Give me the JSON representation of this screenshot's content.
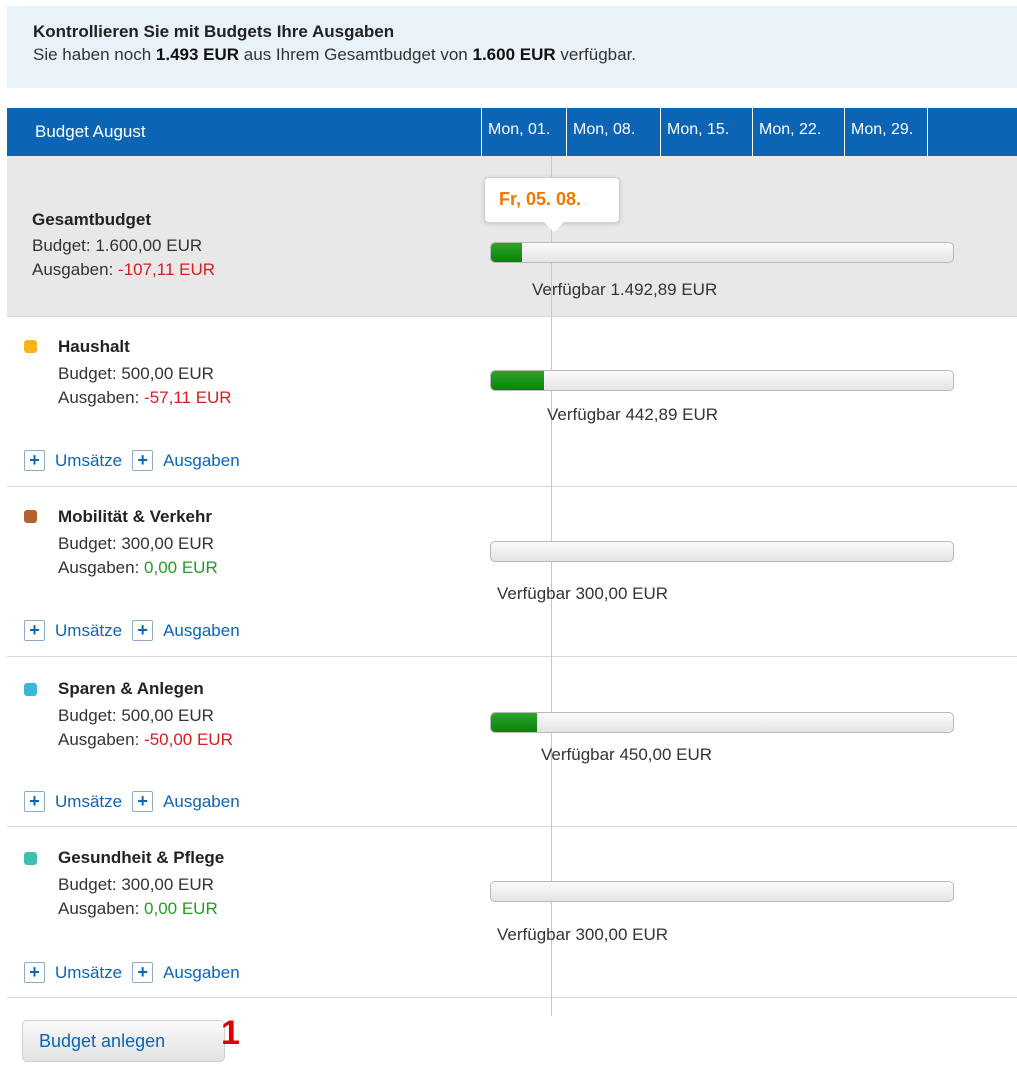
{
  "banner": {
    "title": "Kontrollieren Sie mit Budgets Ihre Ausgaben",
    "text_prefix": "Sie haben noch",
    "remaining": "1.493 EUR",
    "text_mid": "aus Ihrem Gesamtbudget von",
    "total": "1.600 EUR",
    "text_suffix": "verfügbar."
  },
  "header": {
    "title": "Budget August",
    "weeks": [
      "Mon, 01.",
      "Mon, 08.",
      "Mon, 15.",
      "Mon, 22.",
      "Mon, 29."
    ]
  },
  "tooltip": {
    "date": "Fr, 05. 08."
  },
  "total": {
    "name": "Gesamtbudget",
    "budget": "Budget: 1.600,00 EUR",
    "expenses_label": "Ausgaben:",
    "expenses": "-107,11 EUR",
    "available": "Verfügbar  1.492,89 EUR",
    "spent_fraction": 0.067
  },
  "categories": [
    {
      "name": "Haushalt",
      "color": "#f7b418",
      "budget": "Budget: 500,00 EUR",
      "expenses_label": "Ausgaben:",
      "expenses": "-57,11 EUR",
      "expenses_state": "neg",
      "available": "Verfügbar  442,89 EUR",
      "spent_fraction": 0.114,
      "link_transactions": "Umsätze",
      "link_expenses": "Ausgaben"
    },
    {
      "name": "Mobilität & Verkehr",
      "color": "#b0632a",
      "budget": "Budget: 300,00 EUR",
      "expenses_label": "Ausgaben:",
      "expenses": "0,00 EUR",
      "expenses_state": "pos",
      "available": "Verfügbar  300,00 EUR",
      "spent_fraction": 0,
      "link_transactions": "Umsätze",
      "link_expenses": "Ausgaben"
    },
    {
      "name": "Sparen & Anlegen",
      "color": "#3bb7d8",
      "budget": "Budget: 500,00 EUR",
      "expenses_label": "Ausgaben:",
      "expenses": "-50,00 EUR",
      "expenses_state": "neg",
      "available": "Verfügbar  450,00 EUR",
      "spent_fraction": 0.1,
      "link_transactions": "Umsätze",
      "link_expenses": "Ausgaben"
    },
    {
      "name": "Gesundheit & Pflege",
      "color": "#3fc0ac",
      "budget": "Budget: 300,00 EUR",
      "expenses_label": "Ausgaben:",
      "expenses": "0,00 EUR",
      "expenses_state": "pos",
      "available": "Verfügbar  300,00 EUR",
      "spent_fraction": 0,
      "link_transactions": "Umsätze",
      "link_expenses": "Ausgaben"
    }
  ],
  "actions": {
    "plus_icon": "+",
    "create_budget": "Budget anlegen",
    "marker": "1"
  }
}
